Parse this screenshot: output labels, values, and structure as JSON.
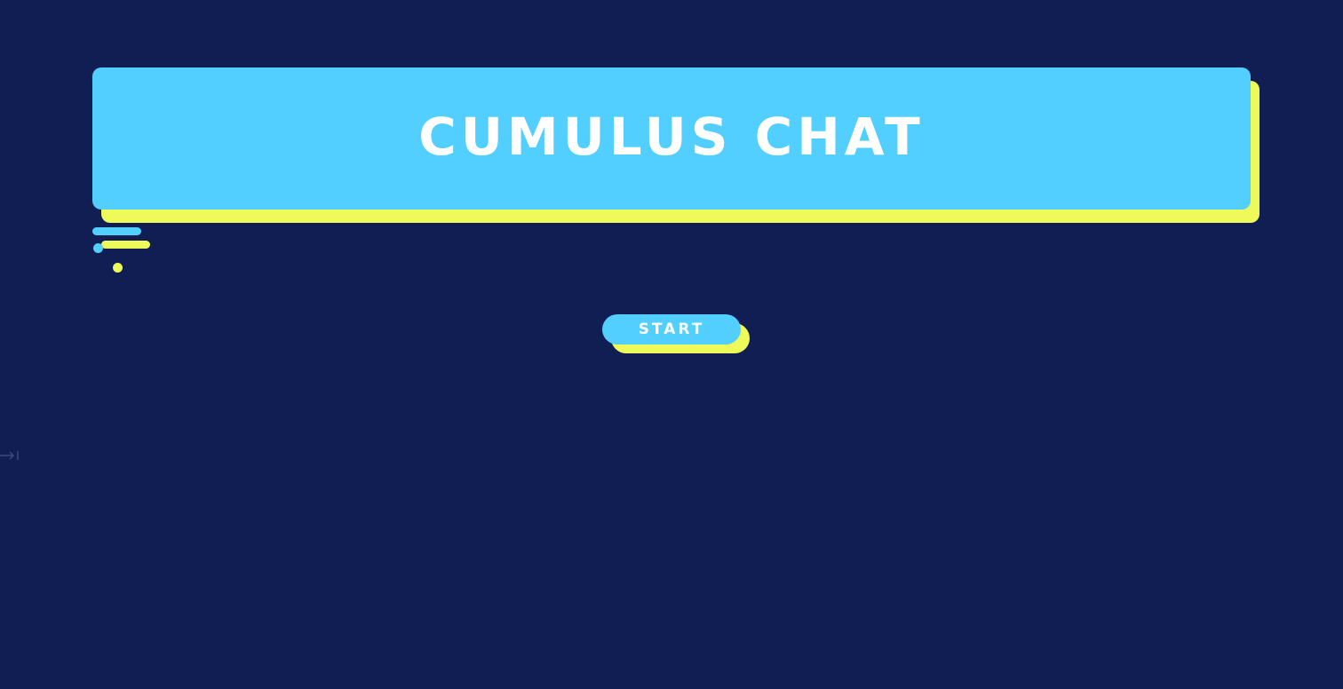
{
  "app": {
    "title": "CUMULUS CHAT",
    "start_label": "START"
  },
  "colors": {
    "background": "#101e54",
    "primary": "#52cffe",
    "accent": "#eefa5a",
    "text": "#ffffff"
  },
  "icons": {
    "edge_widget": "arrow-into-bar-icon"
  }
}
